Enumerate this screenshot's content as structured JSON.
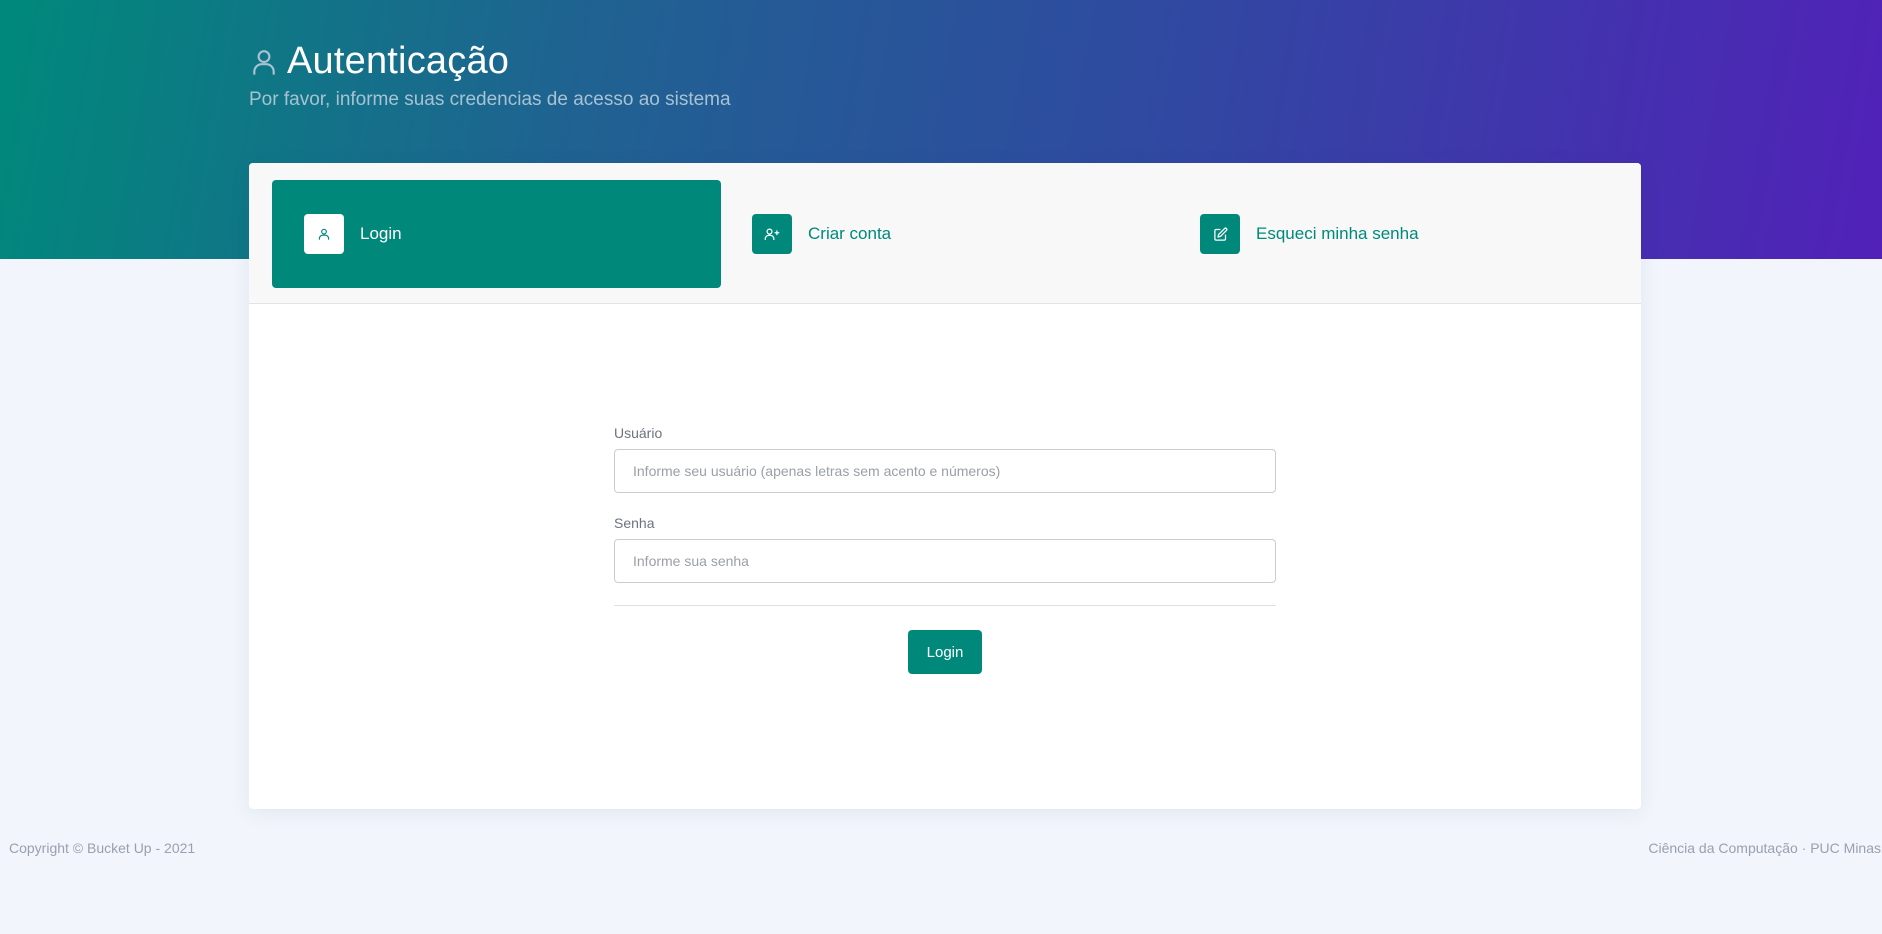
{
  "header": {
    "title": "Autenticação",
    "subtitle": "Por favor, informe suas credencias de acesso ao sistema",
    "icon": "user-icon"
  },
  "tabs": [
    {
      "label": "Login",
      "icon": "user-icon",
      "active": true
    },
    {
      "label": "Criar conta",
      "icon": "user-plus-icon",
      "active": false
    },
    {
      "label": "Esqueci minha senha",
      "icon": "edit-icon",
      "active": false
    }
  ],
  "form": {
    "username": {
      "label": "Usuário",
      "placeholder": "Informe seu usuário (apenas letras sem acento e números)",
      "value": ""
    },
    "password": {
      "label": "Senha",
      "placeholder": "Informe sua senha",
      "value": ""
    },
    "submit_label": "Login"
  },
  "footer": {
    "copyright": "Copyright © Bucket Up - 2021",
    "credits": "Ciência da Computação · PUC Minas"
  },
  "colors": {
    "accent": "#00897b",
    "gradient_start": "#00897b",
    "gradient_end": "#5121b8",
    "background": "#f2f5fb"
  }
}
